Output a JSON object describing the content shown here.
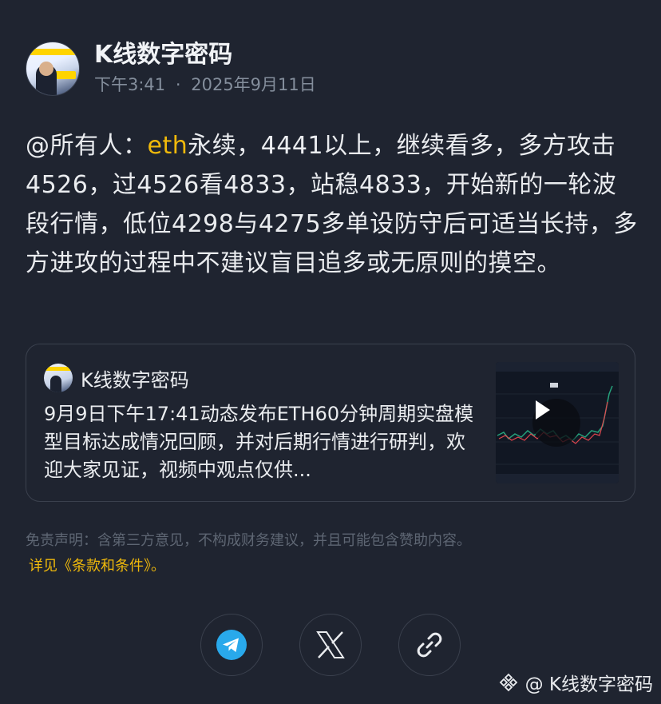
{
  "author": {
    "name": "K线数字密码",
    "time": "下午3:41",
    "separator": "·",
    "date": "2025年9月11日"
  },
  "post": {
    "mention": "@所有人：",
    "highlight": "eth",
    "text": "永续，4441以上，继续看多，多方攻击4526，过4526看4833，站稳4833，开始新的一轮波段行情，低位4298与4275多单设防守后可适当长持，多方进攻的过程中不建议盲目追多或无原则的摸空。"
  },
  "quoted": {
    "name": "K线数字密码",
    "text": "9月9日下午17:41动态发布ETH60分钟周期实盘模型目标达成情况回顾，并对后期行情进行研判，欢迎大家见证，视频中观点仅供..."
  },
  "disclaimer": "免责声明：含第三方意见，不构成财务建议，并且可能包含赞助内容。",
  "terms": "详见《条款和条件》。",
  "share": {
    "telegram_icon": "telegram-icon",
    "x_icon": "x-icon",
    "link_icon": "link-icon"
  },
  "watermark": "@ K线数字密码",
  "colors": {
    "background": "#1f2430",
    "accent": "#f0b90b",
    "muted": "#848e9c",
    "telegram": "#29a9eb"
  }
}
